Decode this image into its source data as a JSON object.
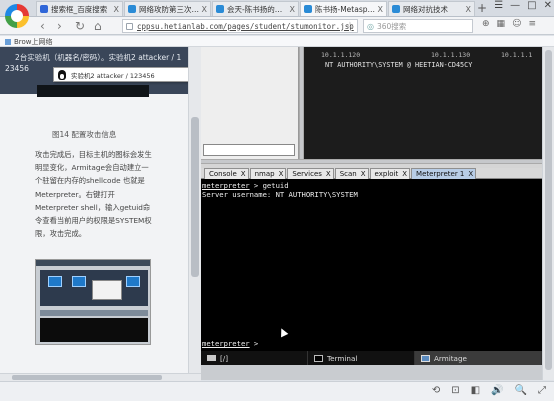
{
  "browser": {
    "tabs": [
      {
        "label": "搜索框_百度搜索",
        "color": "#2f66d8",
        "active": false
      },
      {
        "label": "网络攻防第三次实验",
        "color": "#2a8bd6",
        "active": false
      },
      {
        "label": "会天-陈书扬的实验",
        "color": "#2a8bd6",
        "active": false
      },
      {
        "label": "陈书扬-Metasploit",
        "color": "#2a8bd6",
        "active": true
      },
      {
        "label": "网络对抗技术",
        "color": "#2a8bd6",
        "active": false
      }
    ],
    "tab_close": "X",
    "new_tab": "+",
    "window_controls": [
      "☰",
      "—",
      "□",
      "✕"
    ],
    "nav": {
      "back": "‹",
      "forward": "›",
      "reload": "↻",
      "home": "⌂"
    },
    "url": "cppsu.hetianlab.com/pages/student/stumonitor.jsp",
    "search_placeholder": "360搜索",
    "bookmark": "Brow上网络"
  },
  "doc": {
    "header_line1": "2台实验机（机器名/密码）。实验机2  attacker / 1",
    "header_line2": "23456",
    "tooltip": "实验机2  attacker / 123456",
    "tooltip_arrow": "▾",
    "caption": "图14 配置攻击信息",
    "paragraph": "攻击完成后，目标主机的图标会发生明显变化，Armitage会自动建立一个驻留在内存的shellcode 也就是Meterpreter。右键打开Meterpreter shell，输入getuid命令查看当前用户的权限是SYSTEM权限，攻击完成。"
  },
  "armitage": {
    "graph": {
      "ip_left": "10.1.1.120",
      "ip_mid": "10.1.1.130",
      "ip_right": "10.1.1.1",
      "host_label": "NT AUTHORITY\\SYSTEM @ HEETIAN-CD45CY"
    },
    "tabs": [
      {
        "label": "Console",
        "active": false
      },
      {
        "label": "nmap",
        "active": false
      },
      {
        "label": "Services",
        "active": false
      },
      {
        "label": "Scan",
        "active": false
      },
      {
        "label": "exploit",
        "active": false
      },
      {
        "label": "Meterpreter 1",
        "active": true
      }
    ],
    "tab_close": "X",
    "console": {
      "prompt_word": "meterpreter",
      "cmd_line": " > getuid",
      "output": "Server username: NT AUTHORITY\\SYSTEM",
      "prompt_line": " > "
    },
    "footer": {
      "folder": "[/]",
      "terminal": "Terminal",
      "armitage": "Armitage"
    }
  },
  "statusbar_icons": [
    "⟲",
    "⊡",
    "◧",
    "🔊",
    "🔍",
    "⤢"
  ]
}
